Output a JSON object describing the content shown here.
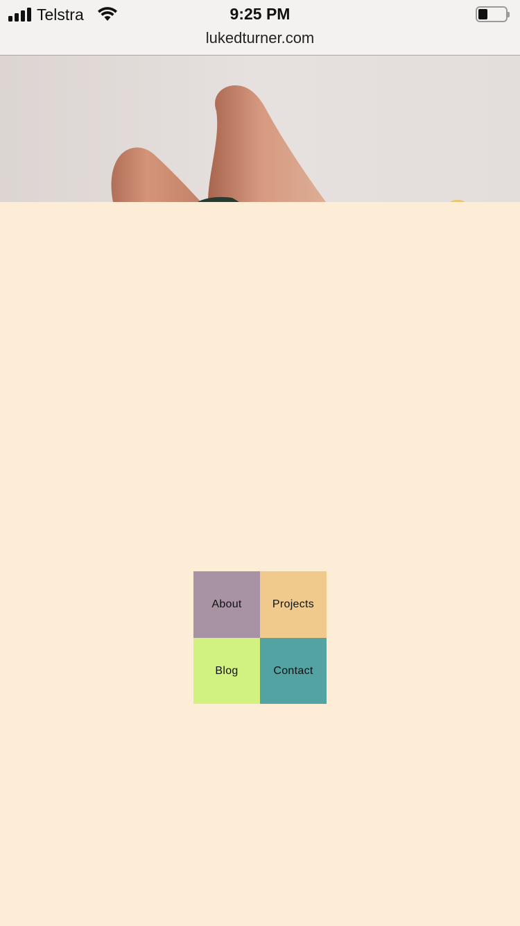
{
  "status_bar": {
    "carrier": "Telstra",
    "time": "9:25 PM",
    "battery_level": 0.25,
    "signal_bars": 4
  },
  "browser": {
    "url": "lukedturner.com"
  },
  "hero": {
    "image_subject": "hand-fingers-image"
  },
  "nav": {
    "items": [
      {
        "label": "About",
        "color": "#a893a4"
      },
      {
        "label": "Projects",
        "color": "#efca8c"
      },
      {
        "label": "Blog",
        "color": "#d1f281"
      },
      {
        "label": "Contact",
        "color": "#53a3a3"
      }
    ]
  },
  "colors": {
    "page_background": "#fdedd6",
    "chrome_background": "#f3f2f1"
  }
}
